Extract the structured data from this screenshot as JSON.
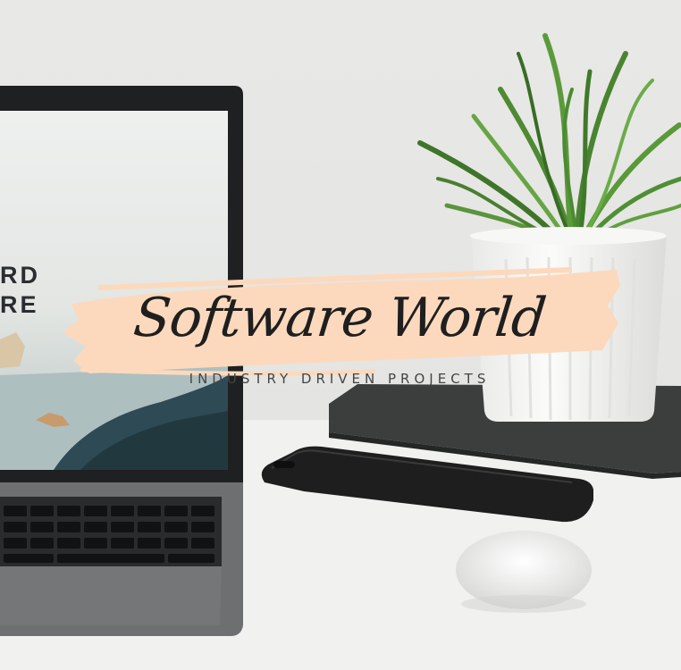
{
  "image": {
    "description_alt": "",
    "screen_text": [
      "RD",
      "RE"
    ]
  },
  "logo": {
    "title": "Software World",
    "tagline": "INDUSTRY DRIVEN PROJECTS",
    "brush_color": "#fcd9bd"
  },
  "palette": {
    "wall": "#e9e9e7",
    "desk": "#f2f2f0",
    "laptop": "#2b2b2d",
    "plant": "#4e8a34",
    "pot": "#f4f4f2",
    "phone": "#1e1e1f"
  }
}
